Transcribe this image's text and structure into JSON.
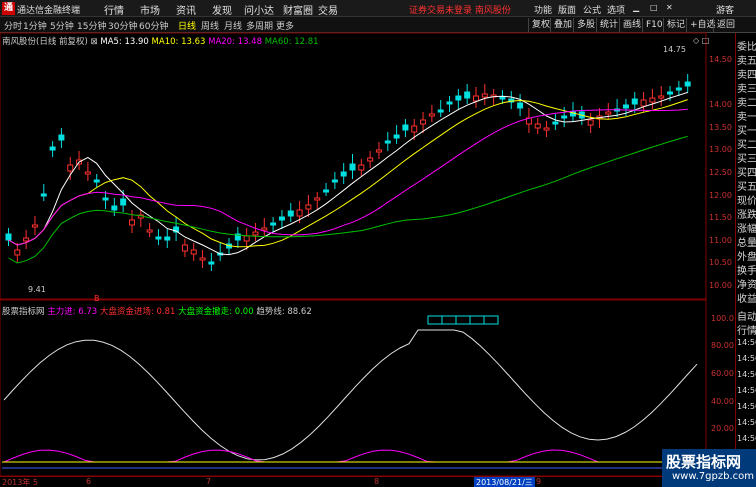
{
  "titlebar": {
    "app_name": "通达信金融终端",
    "menus": [
      "行情",
      "市场",
      "资讯",
      "发现",
      "问小达",
      "财富圈",
      "交易"
    ],
    "notice": "证券交易未登录",
    "stock_name": "南风股份",
    "right_menus": [
      "功能",
      "版面",
      "公式",
      "选项"
    ],
    "user": "游客"
  },
  "toolbar": {
    "timeframes": [
      "分时",
      "1分钟",
      "5分钟",
      "15分钟",
      "30分钟",
      "60分钟",
      "日线",
      "周线",
      "月线",
      "多周期",
      "更多"
    ],
    "active_timeframe": "日线",
    "buttons": [
      "复权",
      "叠加",
      "多股",
      "统计",
      "画线",
      "F10",
      "标记",
      "+自选",
      "返回"
    ]
  },
  "chart": {
    "title": "南风股份(日线 前复权)",
    "ma5": "MA5: 13.90",
    "ma10": "MA10: 13.63",
    "ma20": "MA20: 13.48",
    "ma60": "MA60: 12.81",
    "high_label": "14.75",
    "low_label": "9.41",
    "b_marker": "B",
    "y_labels": [
      "14.50",
      "14.00",
      "13.50",
      "13.00",
      "12.50",
      "12.00",
      "11.50",
      "11.00",
      "10.50",
      "10.00",
      "9.50"
    ]
  },
  "indicator": {
    "name": "股票指标网",
    "main_in": "主力进: 6.73",
    "big_in": "大盘资金进场: 0.81",
    "big_out": "大盘资金撤走: 0.00",
    "trend": "趋势线: 88.62",
    "y_labels": [
      "100.0",
      "80.00",
      "60.00",
      "40.00",
      "20.00"
    ]
  },
  "dates": {
    "ticks": [
      "2013年 5",
      "6",
      "7",
      "8",
      "9"
    ],
    "cursor": "2013/08/21/三"
  },
  "side_panel": [
    "委比",
    "卖五",
    "卖四",
    "卖三",
    "卖二",
    "卖一",
    "买一",
    "买二",
    "买三",
    "买四",
    "买五",
    "现价",
    "涨跌",
    "涨幅",
    "总量",
    "外盘",
    "换手",
    "净资",
    "收益",
    "自动",
    "行情",
    "14:56",
    "14:56",
    "14:56",
    "14:56",
    "14:56",
    "14:56",
    "14:56"
  ],
  "watermark": {
    "line1": "股票指标网",
    "line2": "www.7gpzb.com"
  },
  "colors": {
    "up": "#ff3030",
    "down": "#00e0e0",
    "ma5": "#ffffff",
    "ma10": "#ffff00",
    "ma20": "#ff00ff",
    "ma60": "#00c000"
  }
}
